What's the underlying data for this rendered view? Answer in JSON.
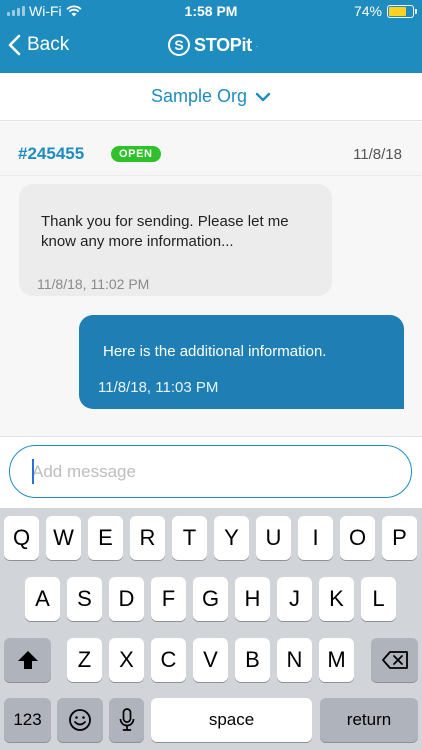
{
  "status_bar": {
    "carrier": "Wi-Fi",
    "time": "1:58 PM",
    "battery": "74%",
    "battery_level": 0.74
  },
  "nav": {
    "back_label": "Back",
    "logo_mark": "S",
    "logo_text": "STOPit",
    "logo_tm": "."
  },
  "org": {
    "name": "Sample Org"
  },
  "ticket": {
    "id": "#245455",
    "status": "OPEN",
    "date": "11/8/18"
  },
  "messages": [
    {
      "direction": "incoming",
      "text": "Thank you for sending. Please let me know any more information...",
      "time": "11/8/18, 11:02 PM"
    },
    {
      "direction": "outgoing",
      "text": "Here is the additional information.",
      "time": "11/8/18, 11:03 PM"
    }
  ],
  "composer": {
    "placeholder": "Add message"
  },
  "keyboard": {
    "row1": [
      "Q",
      "W",
      "E",
      "R",
      "T",
      "Y",
      "U",
      "I",
      "O",
      "P"
    ],
    "row2": [
      "A",
      "S",
      "D",
      "F",
      "G",
      "H",
      "J",
      "K",
      "L"
    ],
    "row3": [
      "Z",
      "X",
      "C",
      "V",
      "B",
      "N",
      "M"
    ],
    "numbers_label": "123",
    "space_label": "space",
    "return_label": "return"
  },
  "colors": {
    "brand": "#1f8cc0",
    "open_badge": "#2fc12a",
    "outgoing_bubble": "#1f7fb4"
  }
}
